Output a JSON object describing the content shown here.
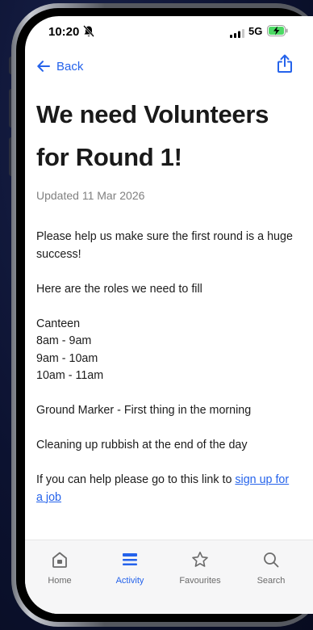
{
  "status_bar": {
    "time": "10:20",
    "network": "5G"
  },
  "nav": {
    "back_label": "Back"
  },
  "article": {
    "title": "We need Volunteers for Round 1!",
    "updated": "Updated 11 Mar 2026",
    "intro": "Please help us make sure the first round is a huge success!",
    "roles_intro": "Here are the roles we need to fill",
    "canteen_heading": "Canteen",
    "canteen_slots": [
      "8am - 9am",
      "9am - 10am",
      "10am - 11am"
    ],
    "ground_marker": "Ground Marker - First thing in the morning",
    "cleanup": "Cleaning up rubbish at the end of the day",
    "cta_text": "If you can help please go to this link to ",
    "cta_link": "sign up for a job"
  },
  "tabs": [
    {
      "label": "Home",
      "icon": "home-icon",
      "active": false
    },
    {
      "label": "Activity",
      "icon": "list-icon",
      "active": true
    },
    {
      "label": "Favourites",
      "icon": "star-icon",
      "active": false
    },
    {
      "label": "Search",
      "icon": "search-icon",
      "active": false
    }
  ],
  "colors": {
    "accent": "#2563eb",
    "background": "#ffffff",
    "tabbar": "#f6f6f7"
  }
}
